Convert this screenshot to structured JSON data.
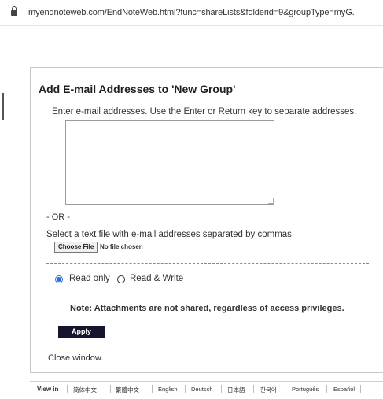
{
  "browser": {
    "url": "myendnoteweb.com/EndNoteWeb.html?func=shareLists&folderid=9&groupType=myG."
  },
  "dialog": {
    "title": "Add E-mail Addresses to 'New Group'",
    "instructions": "Enter e-mail addresses. Use the Enter or Return key to separate addresses.",
    "email_value": "",
    "or_text": "- OR -",
    "file_label": "Select a text file with e-mail addresses separated by commas.",
    "choose_file_label": "Choose File",
    "no_file_text": "No file chosen",
    "access": {
      "selected": "Read only",
      "options": [
        "Read only",
        "Read & Write"
      ]
    },
    "note": "Note: Attachments are not shared, regardless of access privileges.",
    "apply_label": "Apply",
    "close_label": "Close window."
  },
  "language_bar": {
    "view_in": "View in",
    "languages": [
      "简体中文",
      "繁體中文",
      "English",
      "Deutsch",
      "日本語",
      "한국어",
      "Português",
      "Español"
    ]
  },
  "colors": {
    "apply_bg": "#151530",
    "radio_selected": "#2b6fd6"
  }
}
